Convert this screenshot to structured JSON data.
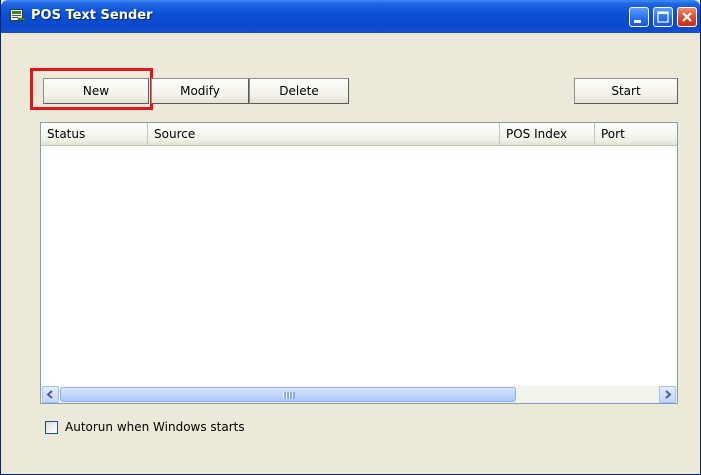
{
  "window": {
    "title": "POS Text Sender",
    "colors": {
      "titlebar": "#0a4fd6",
      "face": "#ece9d8",
      "highlight_box": "#e0161c"
    }
  },
  "toolbar": {
    "new_label": "New",
    "modify_label": "Modify",
    "delete_label": "Delete",
    "start_label": "Start"
  },
  "list": {
    "columns": [
      "Status",
      "Source",
      "POS Index",
      "Port"
    ],
    "rows": []
  },
  "options": {
    "autorun_label": "Autorun when Windows starts",
    "autorun_checked": false
  },
  "icons": {
    "app": "app-icon",
    "minimize": "minimize-icon",
    "maximize": "maximize-icon",
    "close": "close-icon",
    "scroll_left": "arrow-left-icon",
    "scroll_right": "arrow-right-icon"
  }
}
